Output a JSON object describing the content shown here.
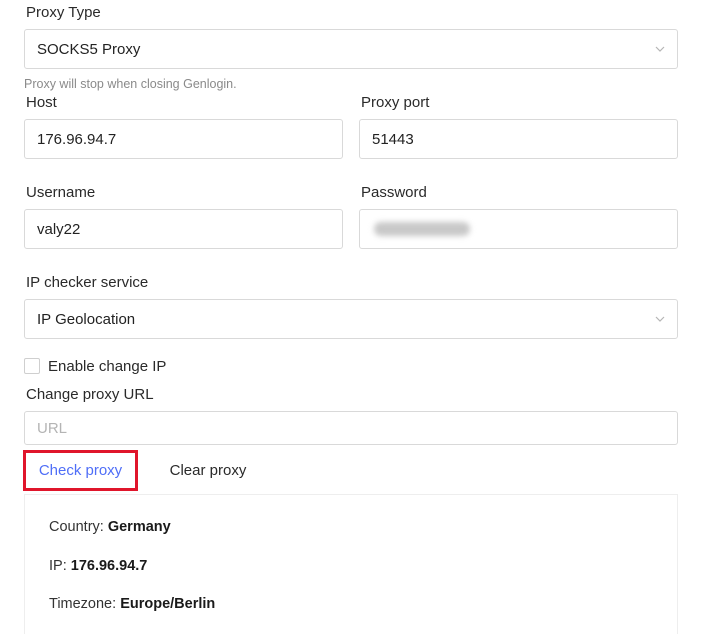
{
  "proxy_type": {
    "label": "Proxy Type",
    "value": "SOCKS5 Proxy",
    "hint": "Proxy will stop when closing Genlogin."
  },
  "host": {
    "label": "Host",
    "value": "176.96.94.7"
  },
  "port": {
    "label": "Proxy port",
    "value": "51443"
  },
  "username": {
    "label": "Username",
    "value": "valy22"
  },
  "password": {
    "label": "Password"
  },
  "ip_checker": {
    "label": "IP checker service",
    "value": "IP Geolocation"
  },
  "change_ip": {
    "label": "Enable change IP",
    "checked": false
  },
  "change_url": {
    "label": "Change proxy URL",
    "placeholder": "URL"
  },
  "buttons": {
    "check": "Check proxy",
    "clear": "Clear proxy"
  },
  "result": {
    "country_label": "Country:",
    "country_value": "Germany",
    "ip_label": "IP:",
    "ip_value": "176.96.94.7",
    "timezone_label": "Timezone:",
    "timezone_value": "Europe/Berlin"
  },
  "colors": {
    "accent": "#4f6ef7",
    "highlight_border": "#e0152b"
  },
  "icons": {
    "select_arrow": "chevron-down-icon"
  }
}
